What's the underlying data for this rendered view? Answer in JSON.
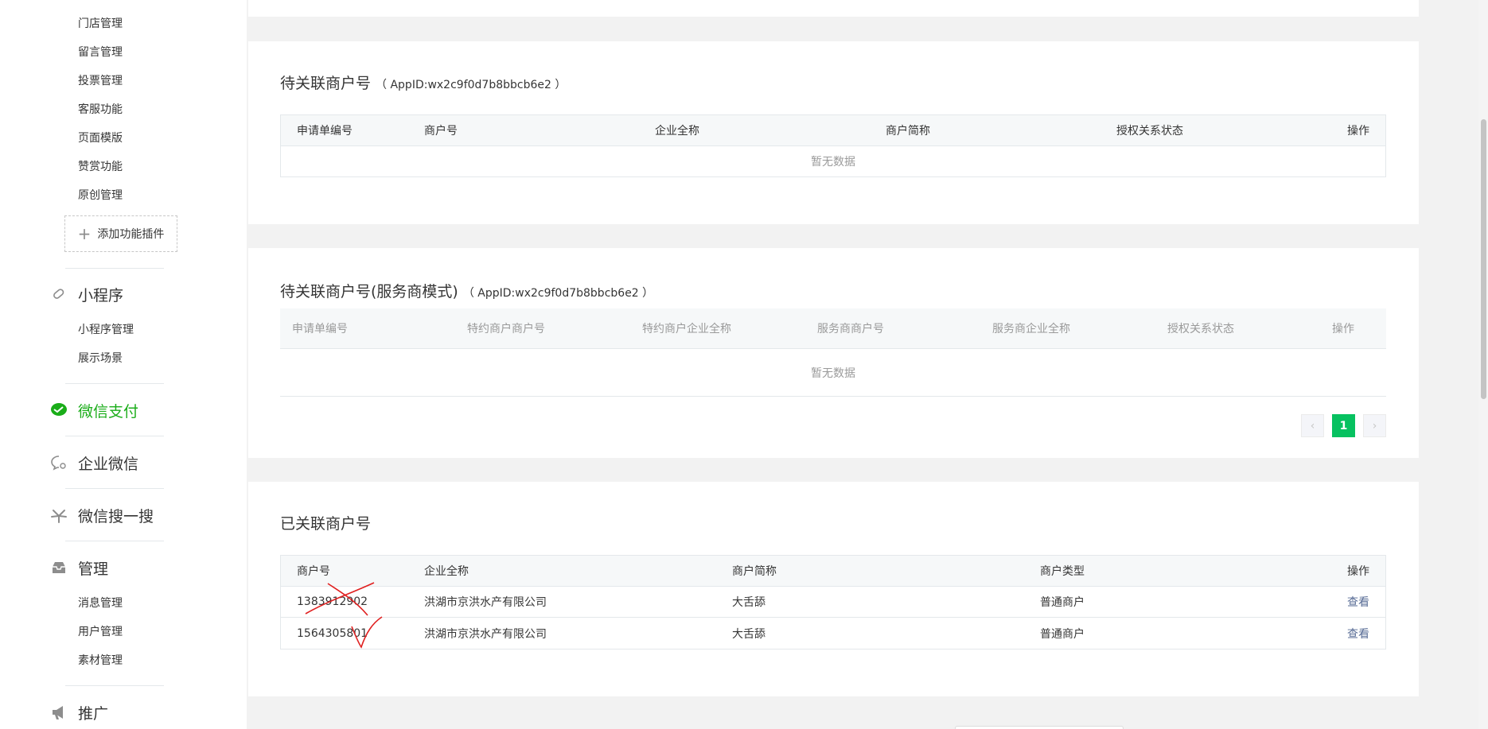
{
  "sidebar": {
    "items_top": [
      "门店管理",
      "留言管理",
      "投票管理",
      "客服功能",
      "页面模版",
      "赞赏功能",
      "原创管理"
    ],
    "add_plugin": "添加功能插件",
    "miniprogram": {
      "label": "小程序",
      "items": [
        "小程序管理",
        "展示场景"
      ]
    },
    "wechat_pay": {
      "label": "微信支付"
    },
    "work_wechat": {
      "label": "企业微信"
    },
    "search": {
      "label": "微信搜一搜"
    },
    "manage": {
      "label": "管理",
      "items": [
        "消息管理",
        "用户管理",
        "素材管理"
      ]
    },
    "promote": {
      "label": "推广"
    },
    "active_color": "#1aad19"
  },
  "pending": {
    "title": "待关联商户号",
    "appid": "（ AppID:wx2c9f0d7b8bbcb6e2 ）",
    "headers": [
      "申请单编号",
      "商户号",
      "企业全称",
      "商户简称",
      "授权关系状态",
      "操作"
    ],
    "empty": "暂无数据"
  },
  "pending_sp": {
    "title": "待关联商户号(服务商模式)",
    "appid": "（ AppID:wx2c9f0d7b8bbcb6e2 ）",
    "headers": [
      "申请单编号",
      "特约商户商户号",
      "特约商户企业全称",
      "服务商商户号",
      "服务商企业全称",
      "授权关系状态",
      "操作"
    ],
    "empty": "暂无数据",
    "pager": {
      "prev": "‹",
      "current": "1",
      "next": "›"
    }
  },
  "linked": {
    "title": "已关联商户号",
    "headers": [
      "商户号",
      "企业全称",
      "商户简称",
      "商户类型",
      "操作"
    ],
    "rows": [
      {
        "mch_id": "1383912902",
        "company": "洪湖市京洪水产有限公司",
        "short": "大舌舔",
        "type": "普通商户",
        "action": "查看"
      },
      {
        "mch_id": "1564305801",
        "company": "洪湖市京洪水产有限公司",
        "short": "大舌舔",
        "type": "普通商户",
        "action": "查看"
      }
    ]
  },
  "colors": {
    "accent": "#07c160",
    "link": "#576b95",
    "annotation": "#e02020"
  }
}
